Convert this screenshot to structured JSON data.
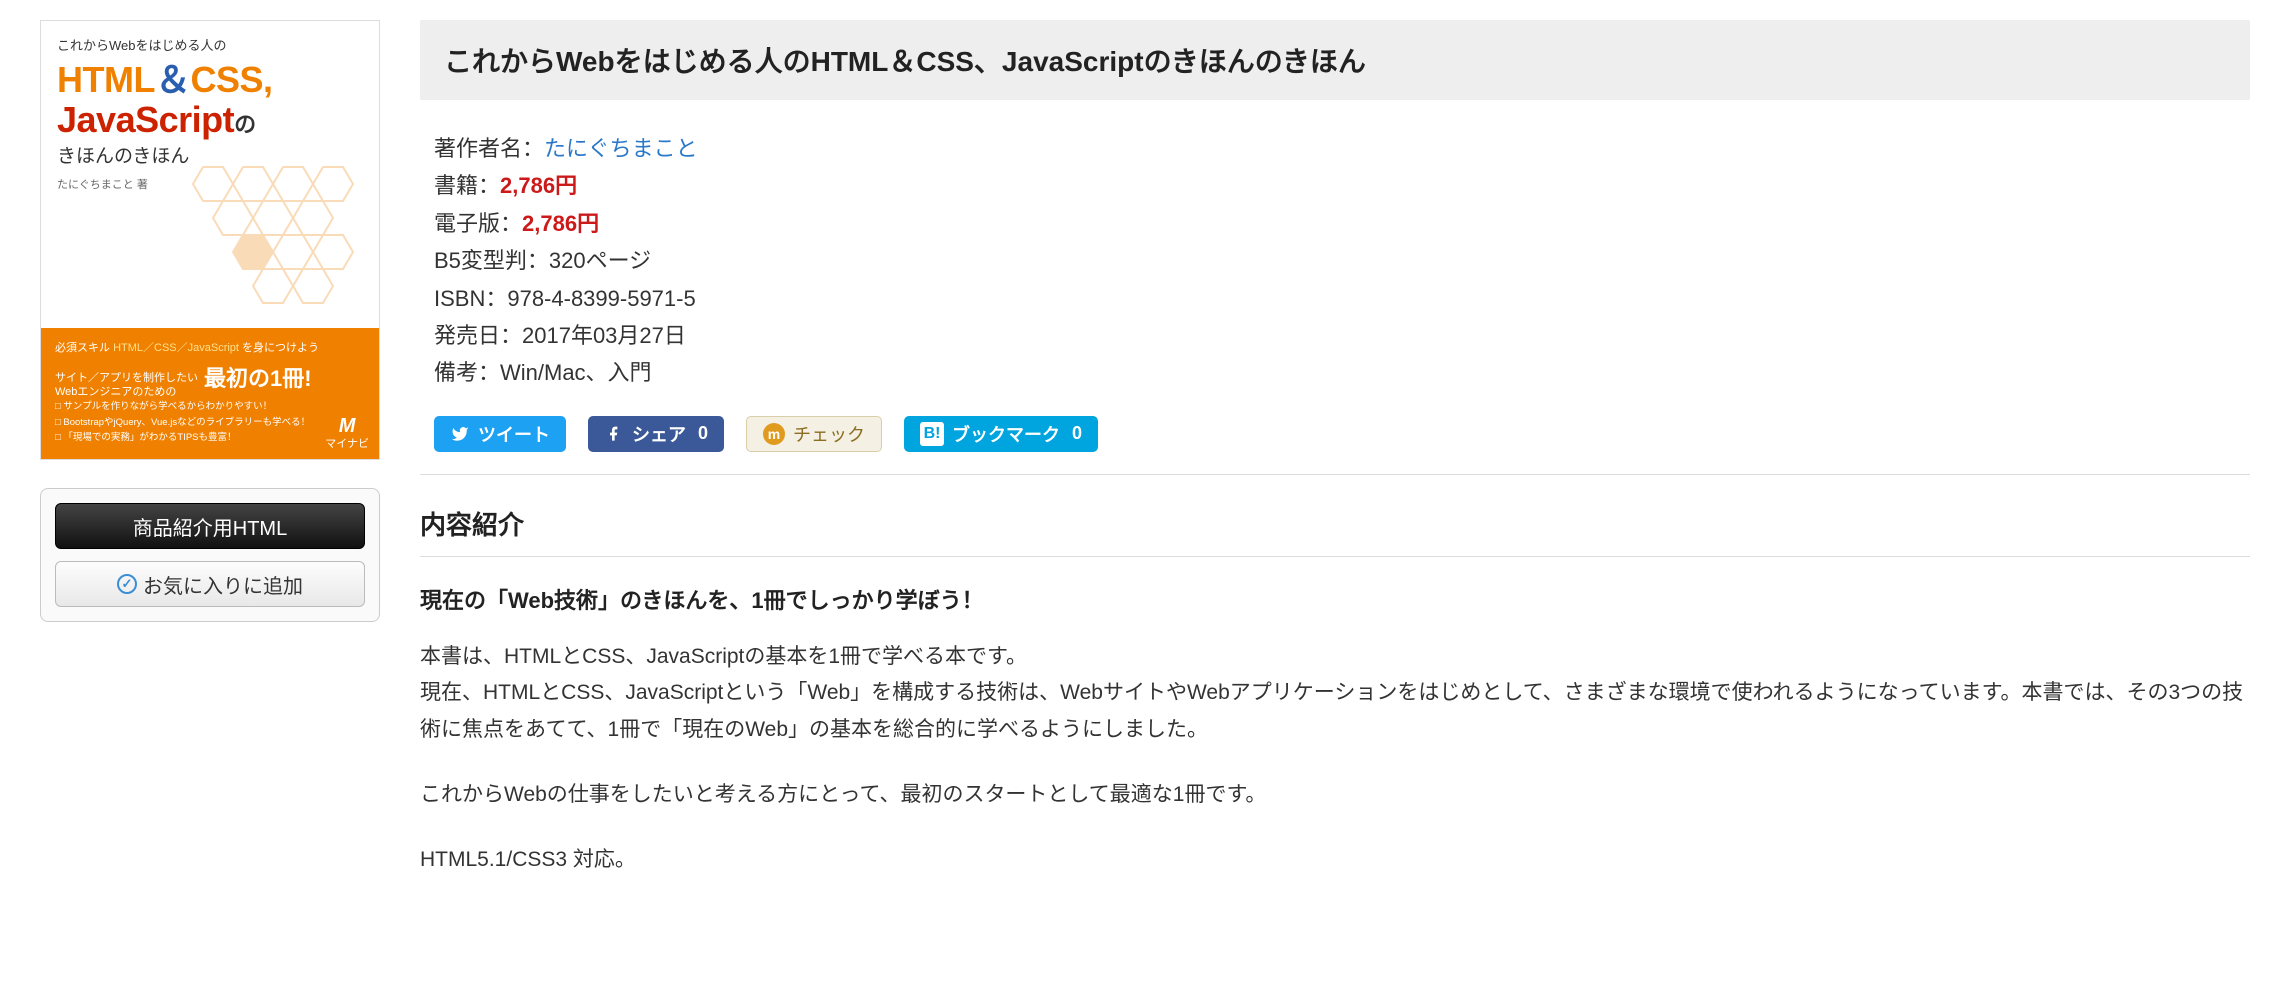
{
  "cover": {
    "pretitle": "これからWebをはじめる人の",
    "title_html": "HTML",
    "title_amp": "＆",
    "title_css": "CSS,",
    "title_js": "JavaScript",
    "title_suffix": "の",
    "subtitle": "きほんのきほん",
    "author_small": "たにぐちまこと 著",
    "band_lead1": "必須スキル",
    "band_skills": "HTML／CSS／JavaScript",
    "band_lead2": "を身につけよう",
    "band_sub1": "サイト／アプリを制作したい",
    "band_sub2": "Webエンジニアのための",
    "band_big": "最初の1冊!",
    "band_li1": "サンプルを作りながら学べるからわかりやすい！",
    "band_li2": "BootstrapやjQuery、Vue.jsなどのライブラリーも学べる！",
    "band_li3": "「現場での実務」がわかるTIPSも豊富！",
    "publisher": "マイナビ"
  },
  "side": {
    "btn_html": "商品紹介用HTML",
    "btn_fav": "お気に入りに追加"
  },
  "title": "これからWebをはじめる人のHTML＆CSS、JavaScriptのきほんのきほん",
  "meta": {
    "author_label": "著作者名：",
    "author_link": "たにぐちまこと",
    "book_label": "書籍：",
    "book_price": "2,786円",
    "ebook_label": "電子版：",
    "ebook_price": "2,786円",
    "format": "B5変型判：320ページ",
    "isbn": "ISBN：978-4-8399-5971-5",
    "release": "発売日：2017年03月27日",
    "note": "備考：Win/Mac、入門"
  },
  "social": {
    "tweet": "ツイート",
    "share": "シェア",
    "share_count": "0",
    "check": "チェック",
    "bookmark": "ブックマーク",
    "bookmark_count": "0"
  },
  "section": {
    "heading": "内容紹介",
    "lead": "現在の「Web技術」のきほんを、1冊でしっかり学ぼう！",
    "p1": "本書は、HTMLとCSS、JavaScriptの基本を1冊で学べる本です。",
    "p2": "現在、HTMLとCSS、JavaScriptという「Web」を構成する技術は、WebサイトやWebアプリケーションをはじめとして、さまざまな環境で使われるようになっています。本書では、その3つの技術に焦点をあてて、1冊で「現在のWeb」の基本を総合的に学べるようにしました。",
    "p3": "これからWebの仕事をしたいと考える方にとって、最初のスタートとして最適な1冊です。",
    "p4": "HTML5.1/CSS3 対応。"
  }
}
